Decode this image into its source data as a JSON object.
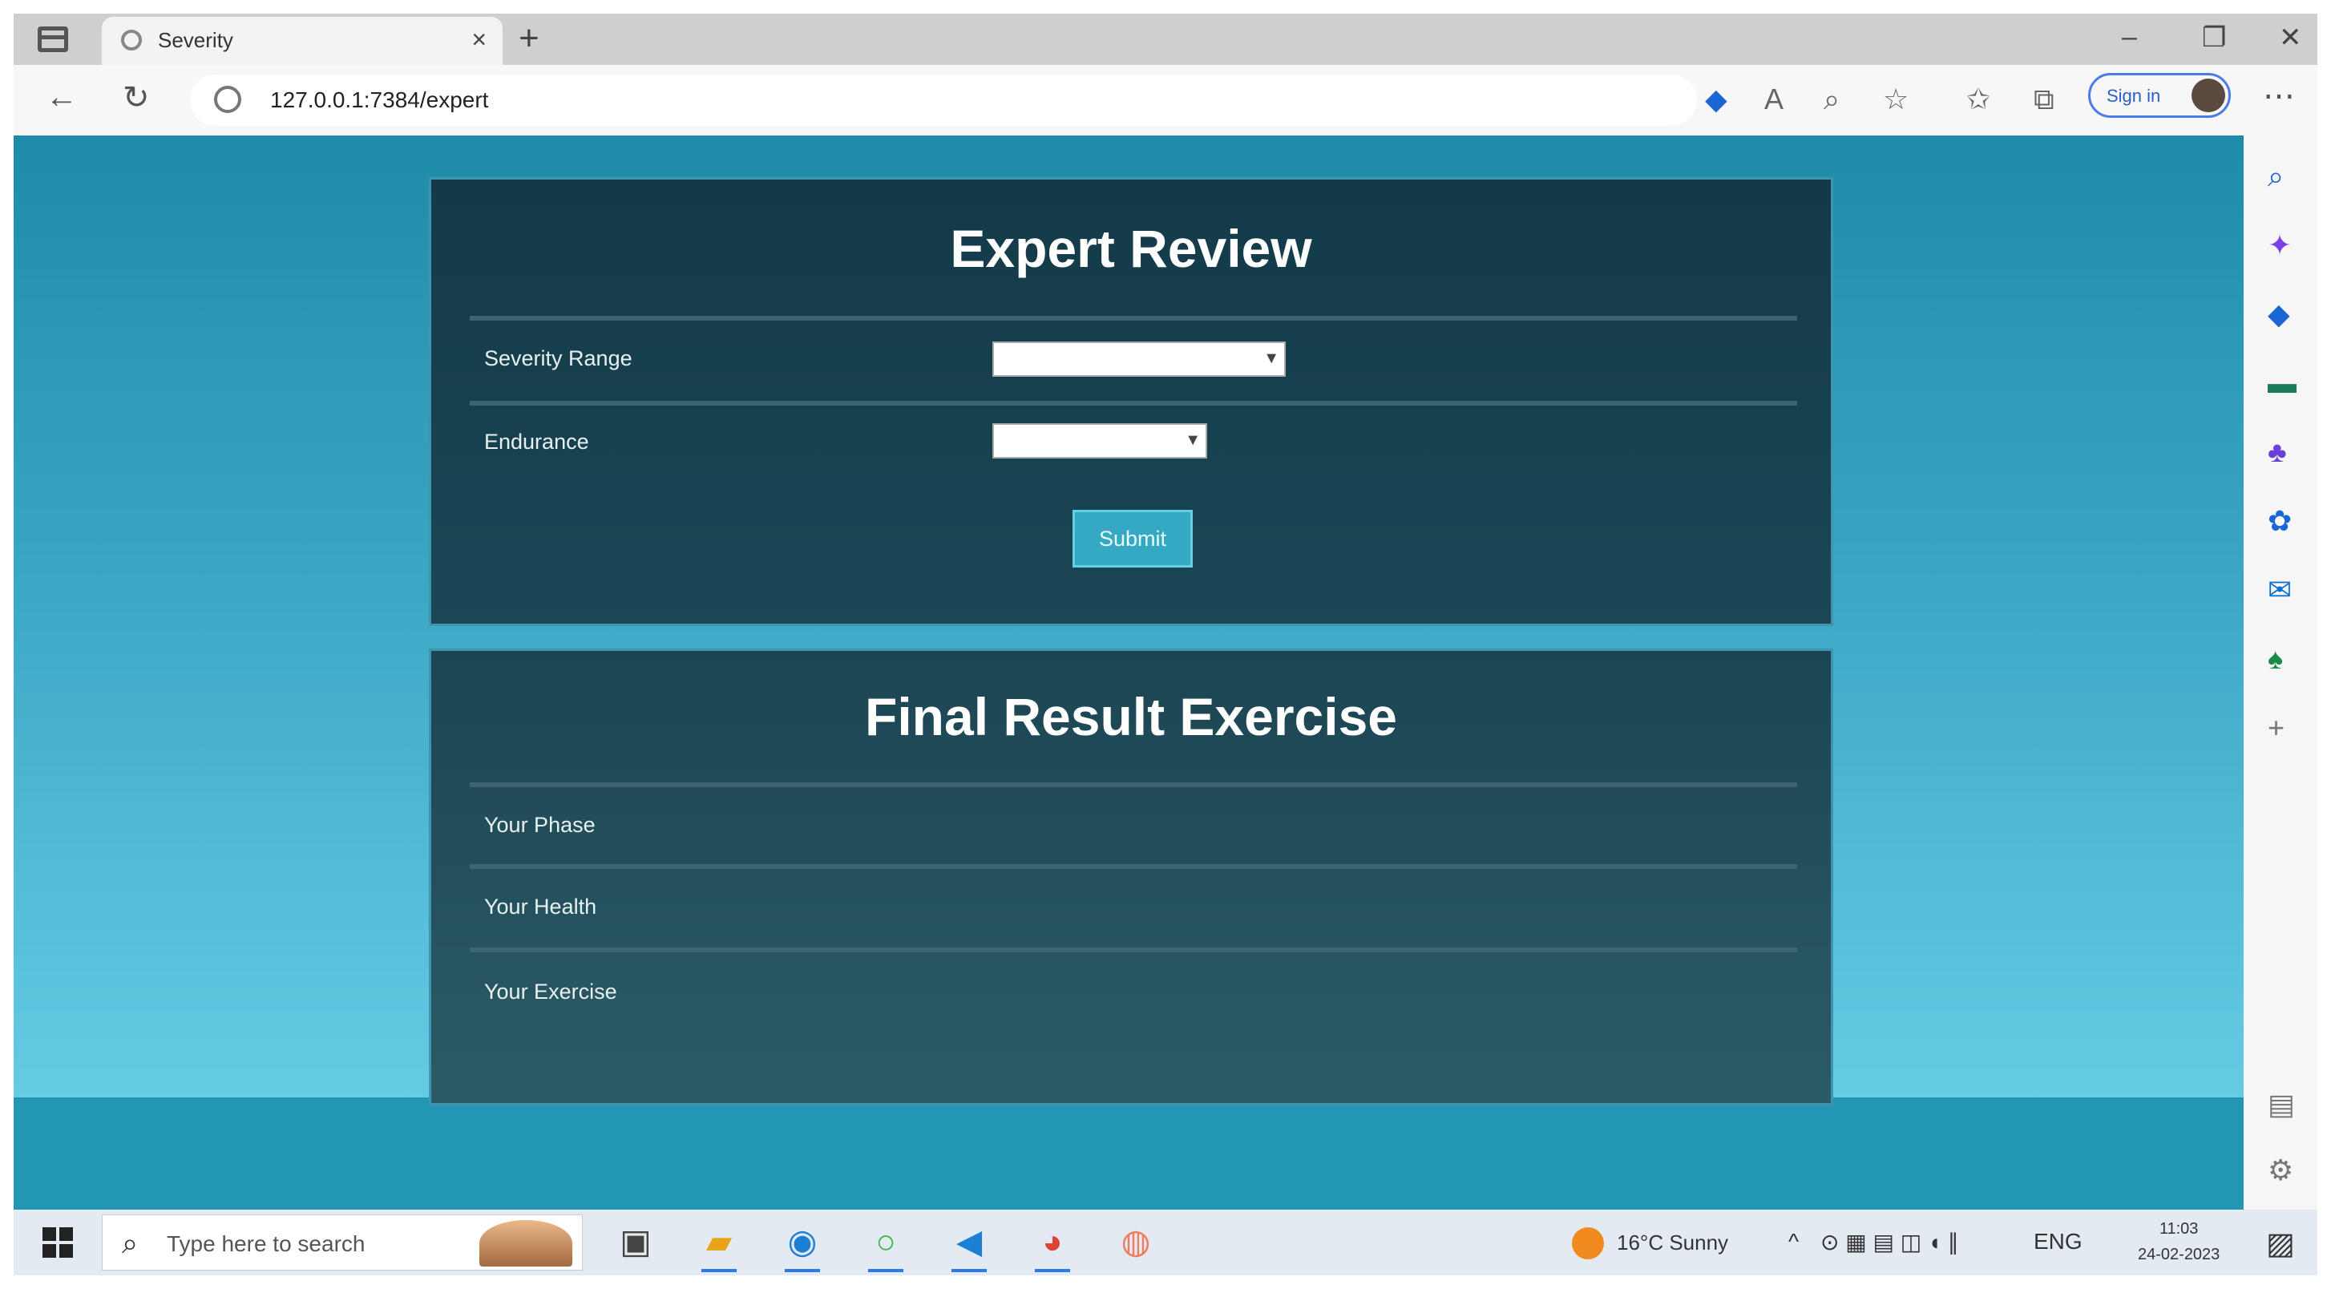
{
  "browser": {
    "tab_title": "Severity",
    "url": "127.0.0.1:7384/expert",
    "sign_in_label": "Sign in"
  },
  "expert_review": {
    "title": "Expert Review",
    "severity_range_label": "Severity Range",
    "severity_range_value": "",
    "endurance_label": "Endurance",
    "endurance_value": "",
    "submit_label": "Submit"
  },
  "final_result": {
    "title": "Final Result Exercise",
    "phase_label": "Your Phase",
    "health_label": "Your Health",
    "exercise_label": "Your Exercise"
  },
  "taskbar": {
    "search_placeholder": "Type here to search",
    "weather": "16°C  Sunny",
    "language": "ENG",
    "time": "11:03",
    "date": "24-02-2023"
  },
  "icons": {
    "start": "windows-logo-icon",
    "search": "search-icon",
    "weather": "sun-icon"
  },
  "colors": {
    "page_top": "#1e8ca8",
    "page_bottom": "#6fd3ec",
    "card_bg": "#173f4e",
    "submit_bg": "#35a9c4"
  }
}
